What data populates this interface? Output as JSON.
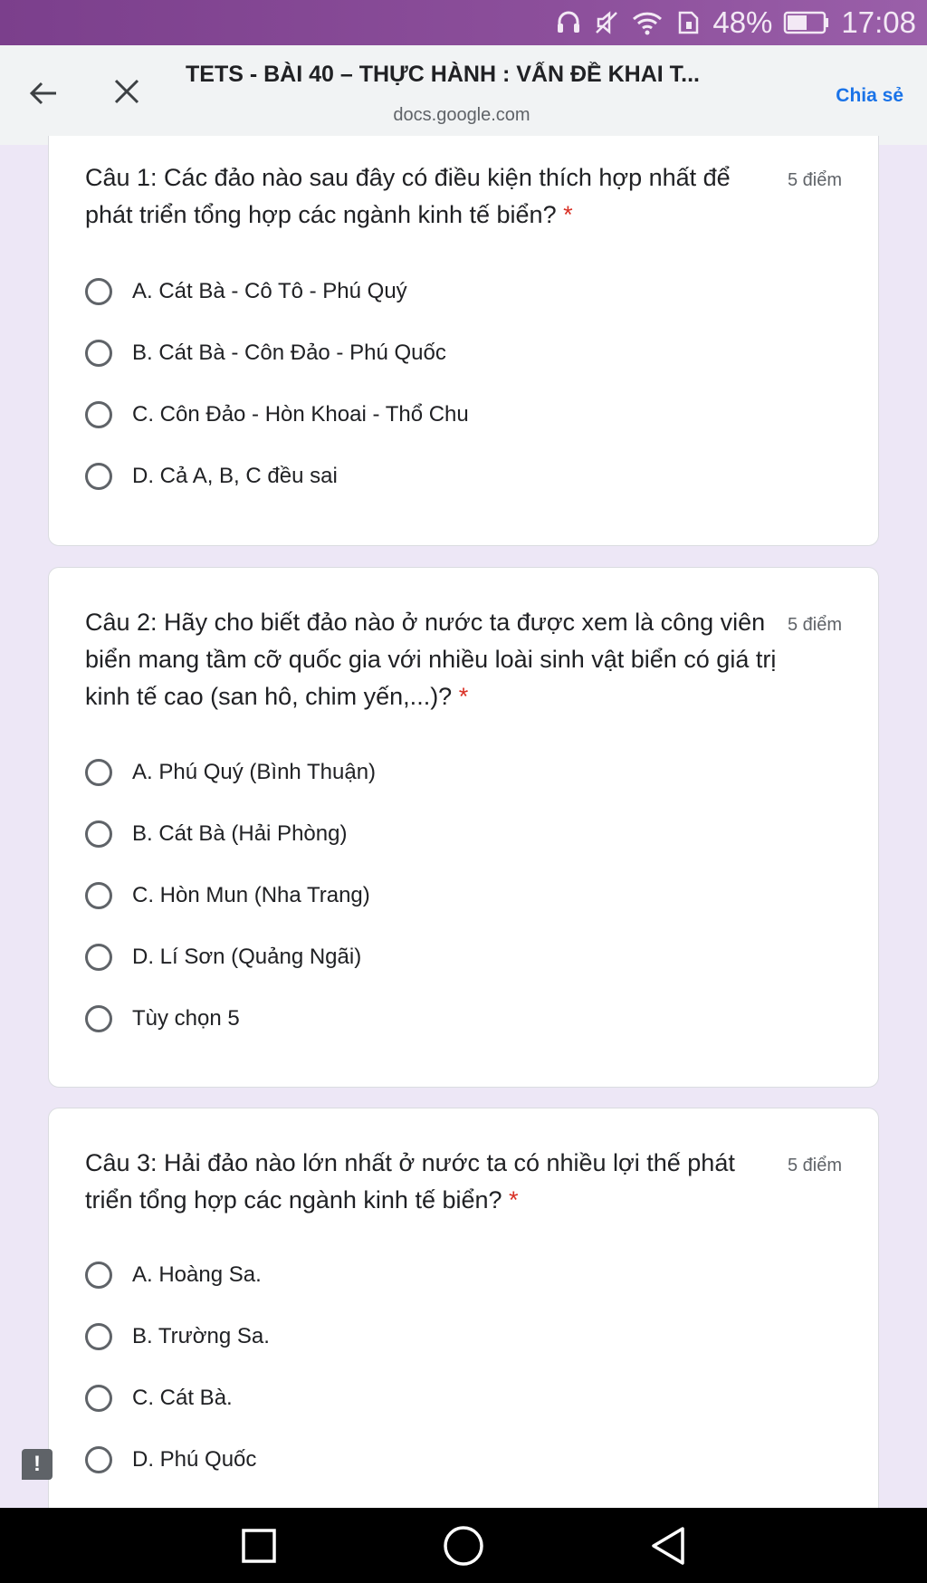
{
  "status_bar": {
    "battery_percent": "48%",
    "time": "17:08",
    "icons": [
      "headset-icon",
      "mute-icon",
      "wifi-icon",
      "sim-icon",
      "battery-icon"
    ]
  },
  "toolbar": {
    "title": "TETS - BÀI 40 – THỰC HÀNH : VẤN ĐỀ KHAI T...",
    "url": "docs.google.com",
    "share_label": "Chia sẻ"
  },
  "questions": [
    {
      "text": "Câu 1: Các đảo nào sau đây có điều kiện thích hợp nhất để phát triển tổng hợp các ngành kinh tế biển?",
      "required": "*",
      "points": "5 điểm",
      "options": [
        "A. Cát Bà - Cô Tô - Phú Quý",
        "B. Cát Bà - Côn Đảo - Phú Quốc",
        "C. Côn Đảo - Hòn Khoai - Thổ Chu",
        "D. Cả A, B, C đều sai"
      ]
    },
    {
      "text": "Câu 2: Hãy cho biết đảo nào ở nước ta được xem là công viên biển mang tầm cỡ quốc gia với nhiều loài sinh vật biển có giá trị kinh tế cao (san hô, chim yến,...)?",
      "required": "*",
      "points": "5 điểm",
      "options": [
        "A. Phú Quý (Bình Thuận)",
        "B. Cát Bà (Hải Phòng)",
        "C. Hòn Mun (Nha Trang)",
        "D. Lí Sơn (Quảng Ngãi)",
        "Tùy chọn 5"
      ]
    },
    {
      "text": "Câu 3: Hải đảo nào lớn nhất ở nước ta có nhiều lợi thế phát triển tổng hợp các ngành kinh tế biển?",
      "required": "*",
      "points": "5 điểm",
      "options": [
        "A. Hoàng Sa.",
        "B. Trường Sa.",
        "C. Cát Bà.",
        "D. Phú Quốc"
      ]
    }
  ],
  "feedback_glyph": "!",
  "colors": {
    "status_bar": "#8c4f9b",
    "toolbar_bg": "#f1f3f4",
    "page_bg": "#ede7f6",
    "accent_blue": "#1a73e8",
    "required_red": "#d93025"
  }
}
